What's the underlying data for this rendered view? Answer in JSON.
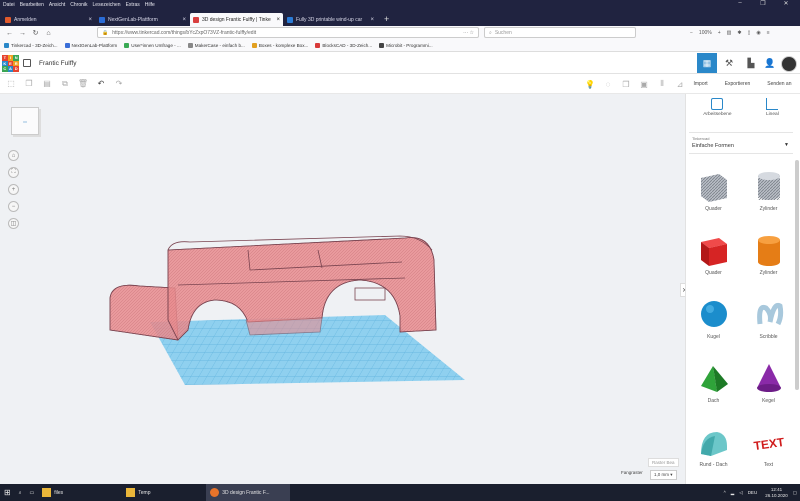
{
  "menubar": {
    "items": [
      "Datei",
      "Bearbeiten",
      "Ansicht",
      "Chronik",
      "Lesezeichen",
      "Extras",
      "Hilfe"
    ]
  },
  "tabs": [
    {
      "label": "Anmelden",
      "color": "#e25a2c",
      "active": false
    },
    {
      "label": "NextGenLab-Plattform",
      "color": "#2a6cd6",
      "active": false
    },
    {
      "label": "3D design Frantic Fulffy | Tinke",
      "color": "#d93f3f",
      "active": true
    },
    {
      "label": "Fully 3D printable wind-up car",
      "color": "#2a7bd6",
      "active": false
    }
  ],
  "nav": {
    "url": "https://www.tinkercad.com/things/bYcZxpO73VZ-frantic-fulffy/edit",
    "search_placeholder": "Suchen",
    "zoom": "100%"
  },
  "bookmarks": [
    {
      "label": "Tinkercad - 3D-Zeich...",
      "color": "#2a88c9"
    },
    {
      "label": "NextGenLab-Plattform",
      "color": "#3a6ed8"
    },
    {
      "label": "User*innen Umfrage - ...",
      "color": "#3aaa55"
    },
    {
      "label": "MakerCase - einfach b...",
      "color": "#888888"
    },
    {
      "label": "Boxes - komplexe Box...",
      "color": "#e2a020"
    },
    {
      "label": "BlocksCAD - 3D-Zeich...",
      "color": "#d83a3a"
    },
    {
      "label": "Microbit - Programmi...",
      "color": "#444444"
    }
  ],
  "header": {
    "project_name": "Frantic Fulffy",
    "logo_letters": [
      "T",
      "I",
      "N",
      "K",
      "E",
      "R",
      "C",
      "A",
      "D"
    ]
  },
  "panel": {
    "actions": [
      "Import",
      "Exportieren",
      "Senden an"
    ],
    "tools": [
      "Arbeitsebene",
      "Lineal"
    ],
    "library_small": "Tinkercad",
    "library_name": "Einfache Formen",
    "shapes": [
      {
        "label": "Quader"
      },
      {
        "label": "Zylinder"
      },
      {
        "label": "Quader"
      },
      {
        "label": "Zylinder"
      },
      {
        "label": "Kugel"
      },
      {
        "label": "Scribble"
      },
      {
        "label": "Dach"
      },
      {
        "label": "Kegel"
      },
      {
        "label": "Rund - Dach"
      },
      {
        "label": "Text"
      }
    ],
    "text_shape_word": "TEXT"
  },
  "workplane": {
    "edit_grid": "Raster Bea",
    "snap_label": "Fangraster",
    "snap_value": "1,0 mm ▾"
  },
  "colors": {
    "accent": "#2a88c9",
    "taskbar": "#1a1f2e",
    "chrome": "#202340",
    "model": "#e98c8f",
    "plate": "#7ec8ea"
  },
  "taskbar": {
    "items": [
      {
        "label": "files"
      },
      {
        "label": "Temp"
      },
      {
        "label": "3D design Frantic F..."
      }
    ],
    "lang": "DEU",
    "time": "12:41",
    "date": "26.10.2020"
  }
}
